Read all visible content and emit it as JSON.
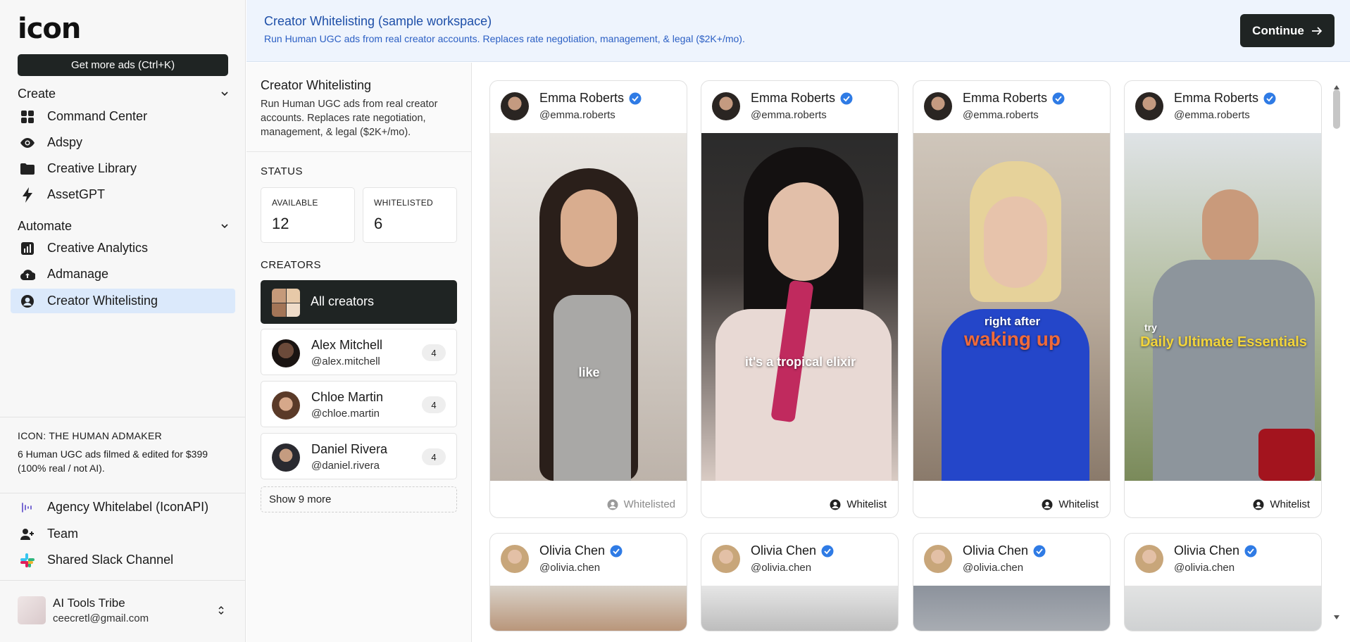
{
  "sidebar": {
    "logo": "icon",
    "get_more": "Get more ads (Ctrl+K)",
    "create_label": "Create",
    "create_items": [
      {
        "label": "Command Center",
        "icon": "grid-icon"
      },
      {
        "label": "Adspy",
        "icon": "eye-icon"
      },
      {
        "label": "Creative Library",
        "icon": "folder-icon"
      },
      {
        "label": "AssetGPT",
        "icon": "bolt-icon"
      }
    ],
    "automate_label": "Automate",
    "automate_items": [
      {
        "label": "Creative Analytics",
        "icon": "bar-chart-icon"
      },
      {
        "label": "Admanage",
        "icon": "cloud-upload-icon"
      },
      {
        "label": "Creator Whitelisting",
        "icon": "user-circle-icon"
      }
    ],
    "promo_title": "ICON: THE HUMAN ADMAKER",
    "promo_text": "6 Human UGC ads filmed & edited for $399 (100% real / not AI).",
    "bottom_items": [
      {
        "label": "Agency Whitelabel (IconAPI)",
        "icon": "soundwave-icon"
      },
      {
        "label": "Team",
        "icon": "user-plus-icon"
      },
      {
        "label": "Shared Slack Channel",
        "icon": "slack-icon"
      }
    ],
    "account": {
      "name": "AI Tools Tribe",
      "email": "ceecretl@gmail.com"
    }
  },
  "banner": {
    "title": "Creator Whitelisting (sample workspace)",
    "subtitle": "Run Human UGC ads from real creator accounts. Replaces rate negotiation, management, & legal ($2K+/mo).",
    "continue": "Continue"
  },
  "panel": {
    "title": "Creator Whitelisting",
    "desc": "Run Human UGC ads from real creator accounts. Replaces rate negotiation, management, & legal ($2K+/mo).",
    "status_label": "STATUS",
    "available_label": "AVAILABLE",
    "available_value": "12",
    "whitelisted_label": "WHITELISTED",
    "whitelisted_value": "6",
    "creators_label": "CREATORS",
    "all_creators": "All creators",
    "creators": [
      {
        "name": "Alex Mitchell",
        "handle": "@alex.mitchell",
        "count": "4"
      },
      {
        "name": "Chloe Martin",
        "handle": "@chloe.martin",
        "count": "4"
      },
      {
        "name": "Daniel Rivera",
        "handle": "@daniel.rivera",
        "count": "4"
      }
    ],
    "show_more": "Show 9 more"
  },
  "cards": [
    {
      "name": "Emma Roberts",
      "handle": "@emma.roberts",
      "caption": "like",
      "action": "Whitelisted"
    },
    {
      "name": "Emma Roberts",
      "handle": "@emma.roberts",
      "caption": "it's a tropical elixir",
      "action": "Whitelist"
    },
    {
      "name": "Emma Roberts",
      "handle": "@emma.roberts",
      "caption_top": "right after",
      "caption": "waking up",
      "action": "Whitelist"
    },
    {
      "name": "Emma Roberts",
      "handle": "@emma.roberts",
      "caption_top": "try",
      "caption": "Daily Ultimate Essentials",
      "action": "Whitelist"
    }
  ],
  "cards_row2": [
    {
      "name": "Olivia Chen",
      "handle": "@olivia.chen"
    },
    {
      "name": "Olivia Chen",
      "handle": "@olivia.chen"
    },
    {
      "name": "Olivia Chen",
      "handle": "@olivia.chen"
    },
    {
      "name": "Olivia Chen",
      "handle": "@olivia.chen"
    }
  ],
  "colors": {
    "dark_button": "#1f2423",
    "banner_bg": "#eef4fd",
    "banner_title": "#1e4fa8",
    "verified": "#2f7be5",
    "active_nav": "#dbe9fb"
  }
}
